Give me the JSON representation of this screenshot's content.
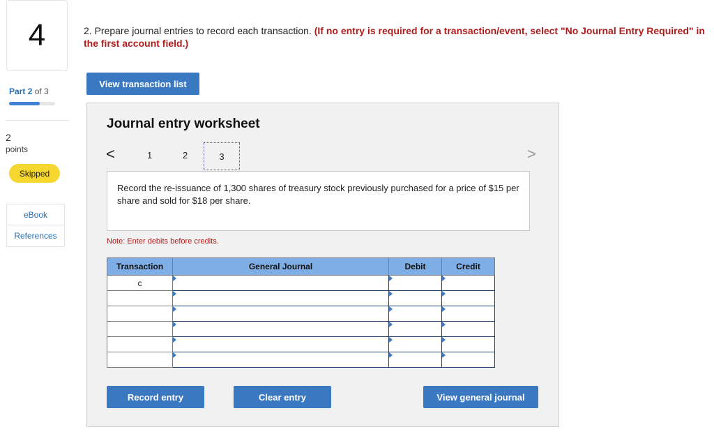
{
  "question": {
    "number": "4",
    "part_label": "Part",
    "part_num": "2",
    "part_of": "of 3",
    "progress": 0.67
  },
  "points": {
    "value": "2",
    "label": "points"
  },
  "status_badge": "Skipped",
  "resources": {
    "ebook": "eBook",
    "references": "References"
  },
  "prompt": {
    "lead": "2. Prepare journal entries to record each transaction. ",
    "instruction": "(If no entry is required for a transaction/event, select \"No Journal Entry Required\" in the first account field.)"
  },
  "view_transaction_list": "View transaction list",
  "worksheet": {
    "title": "Journal entry worksheet",
    "prev": "<",
    "next": ">",
    "pages": [
      "1",
      "2",
      "3"
    ],
    "description": "Record the re-issuance of 1,300 shares of treasury stock previously purchased for a price of $15 per share and sold for $18 per share.",
    "note": "Note: Enter debits before credits.",
    "table": {
      "headers": [
        "Transaction",
        "General Journal",
        "Debit",
        "Credit"
      ],
      "rows": [
        {
          "transaction": "c",
          "account": "",
          "debit": "",
          "credit": ""
        },
        {
          "transaction": "",
          "account": "",
          "debit": "",
          "credit": ""
        },
        {
          "transaction": "",
          "account": "",
          "debit": "",
          "credit": ""
        },
        {
          "transaction": "",
          "account": "",
          "debit": "",
          "credit": ""
        },
        {
          "transaction": "",
          "account": "",
          "debit": "",
          "credit": ""
        },
        {
          "transaction": "",
          "account": "",
          "debit": "",
          "credit": ""
        }
      ]
    },
    "buttons": {
      "record": "Record entry",
      "clear": "Clear entry",
      "view_general_journal": "View general journal"
    }
  }
}
